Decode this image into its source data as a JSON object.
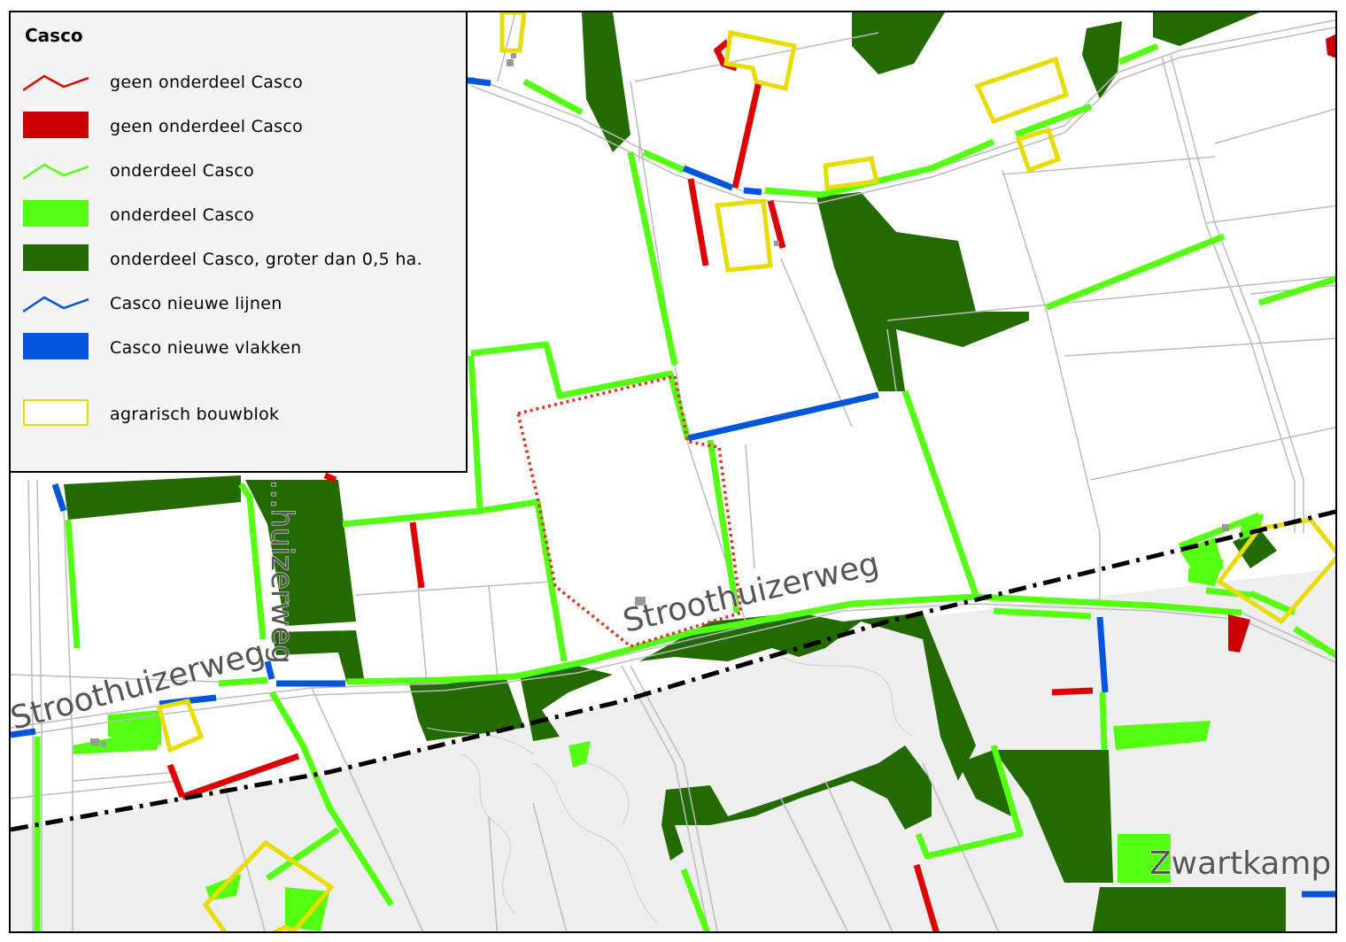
{
  "legend": {
    "title": "Casco",
    "items": [
      {
        "label": "geen onderdeel Casco",
        "kind": "line",
        "color": "#dd0000"
      },
      {
        "label": "geen onderdeel Casco",
        "kind": "area",
        "color": "#cc0000"
      },
      {
        "label": "onderdeel Casco",
        "kind": "line",
        "color": "#55ff11"
      },
      {
        "label": "onderdeel Casco",
        "kind": "area",
        "color": "#55ff11"
      },
      {
        "label": "onderdeel Casco, groter dan 0,5 ha.",
        "kind": "area",
        "color": "#236b00"
      },
      {
        "label": "Casco nieuwe lijnen",
        "kind": "line",
        "color": "#0055dd"
      },
      {
        "label": "Casco nieuwe vlakken",
        "kind": "area",
        "color": "#0055dd"
      },
      {
        "label": "agrarisch bouwblok",
        "kind": "outline",
        "color": "#e8dc00"
      }
    ]
  },
  "map": {
    "road_labels": {
      "main": "Stroothuizerweg",
      "left": "Stroothuizerweg",
      "vertical": "...huizerweg",
      "corner": "Zwartkamp"
    },
    "colors": {
      "road": "#bbbbbb",
      "nature_area": "#eeeeee",
      "boundary_line": "#000000",
      "plan_area": "#dd3322"
    }
  }
}
